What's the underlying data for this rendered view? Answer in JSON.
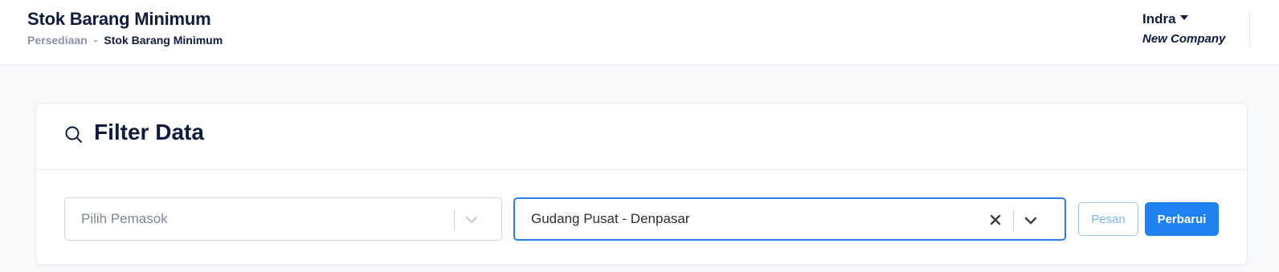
{
  "header": {
    "title": "Stok Barang Minimum",
    "breadcrumb": {
      "parent": "Persediaan",
      "separator": "-",
      "current": "Stok Barang Minimum"
    },
    "user": {
      "name": "Indra",
      "company": "New Company"
    }
  },
  "filter_card": {
    "title": "Filter Data",
    "supplier_select": {
      "placeholder": "Pilih Pemasok",
      "value": ""
    },
    "warehouse_select": {
      "value": "Gudang Pusat - Denpasar"
    },
    "buttons": {
      "order_label": "Pesan",
      "refresh_label": "Perbarui"
    }
  },
  "colors": {
    "primary": "#1f82f2",
    "focus_border": "#2b7de9",
    "text_dark": "#0f1c3f",
    "muted": "#8a93ad",
    "page_background": "#f8f9fb"
  },
  "icons": {
    "search": "search-icon",
    "clear": "close-icon",
    "dropdown": "chevron-down-icon",
    "user_menu": "caret-down-icon"
  }
}
